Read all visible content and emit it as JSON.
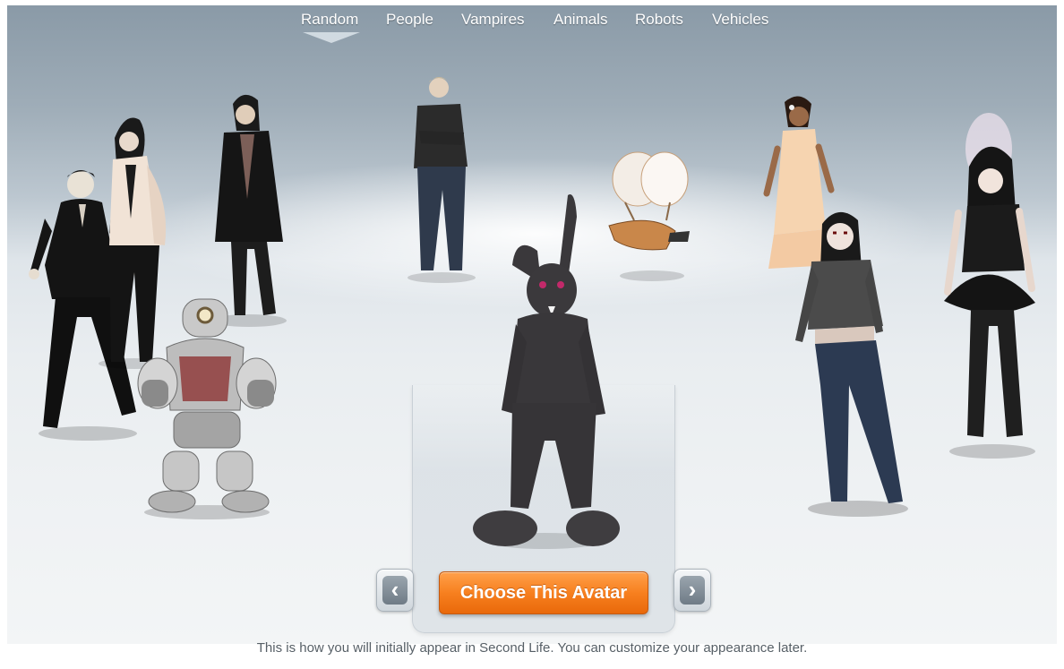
{
  "nav": {
    "tabs": [
      {
        "label": "Random",
        "active": true
      },
      {
        "label": "People"
      },
      {
        "label": "Vampires"
      },
      {
        "label": "Animals"
      },
      {
        "label": "Robots"
      },
      {
        "label": "Vehicles"
      }
    ]
  },
  "avatars": [
    {
      "name": "vampire-man",
      "label": ""
    },
    {
      "name": "woman-scarf",
      "label": ""
    },
    {
      "name": "man-long-coat",
      "label": ""
    },
    {
      "name": "robot",
      "label": ""
    },
    {
      "name": "man-jeans",
      "label": ""
    },
    {
      "name": "airship",
      "label": ""
    },
    {
      "name": "bunny",
      "label": ""
    },
    {
      "name": "woman-dress",
      "label": ""
    },
    {
      "name": "woman-jeans",
      "label": ""
    },
    {
      "name": "woman-tutu",
      "label": ""
    }
  ],
  "controls": {
    "prev_icon": "chevron-left-icon",
    "next_icon": "chevron-right-icon",
    "prev_glyph": "‹",
    "next_glyph": "›",
    "choose_label": "Choose This Avatar"
  },
  "footer": {
    "note": "This is how you will initially appear in Second Life. You can customize your appearance later."
  },
  "colors": {
    "accent_orange": "#f7801f",
    "nav_text": "#ffffff",
    "footer_text": "#565f66"
  }
}
